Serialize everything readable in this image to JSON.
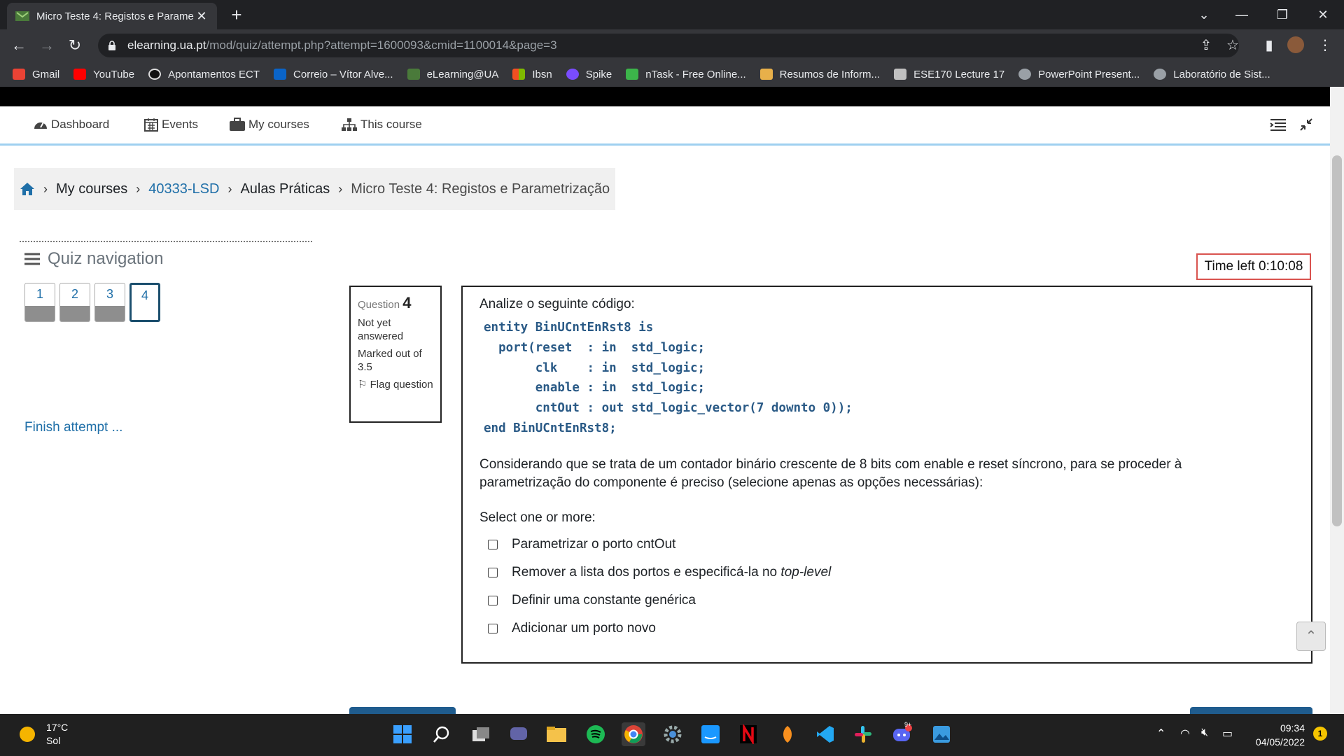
{
  "browser": {
    "tab_title": "Micro Teste 4: Registos e Parame",
    "tab_close": "✕",
    "new_tab": "+",
    "url_host": "elearning.ua.pt",
    "url_path": "/mod/quiz/attempt.php?attempt=1600093&cmid=1100014&page=3",
    "bookmarks": [
      {
        "label": "Gmail",
        "icon": "gmail-icon",
        "color": "#ea4335"
      },
      {
        "label": "YouTube",
        "icon": "youtube-icon",
        "color": "#ff0000"
      },
      {
        "label": "Apontamentos ECT",
        "icon": "ect-icon",
        "color": "#111111"
      },
      {
        "label": "Correio – Vítor Alve...",
        "icon": "outlook-icon",
        "color": "#0a64c8"
      },
      {
        "label": "eLearning@UA",
        "icon": "elearning-icon",
        "color": "#4a7a3a"
      },
      {
        "label": "Ibsn",
        "icon": "windows-icon",
        "color": "#f25022"
      },
      {
        "label": "Spike",
        "icon": "spike-icon",
        "color": "#7a4cff"
      },
      {
        "label": "nTask - Free Online...",
        "icon": "ntask-icon",
        "color": "#3cb54a"
      },
      {
        "label": "Resumos de Inform...",
        "icon": "box-icon",
        "color": "#e8b04a"
      },
      {
        "label": "ESE170 Lecture 17",
        "icon": "shield-icon",
        "color": "#c0c0c0"
      },
      {
        "label": "PowerPoint Present...",
        "icon": "globe-icon",
        "color": "#9aa0a6"
      },
      {
        "label": "Laboratório de Sist...",
        "icon": "globe-icon",
        "color": "#9aa0a6"
      }
    ]
  },
  "nav": {
    "dashboard": "Dashboard",
    "events": "Events",
    "my_courses": "My courses",
    "this_course": "This course"
  },
  "breadcrumb": {
    "items": [
      "My courses",
      "40333-LSD",
      "Aulas Práticas",
      "Micro Teste 4: Registos e Parametrização"
    ]
  },
  "quiz_nav": {
    "title": "Quiz navigation",
    "questions": [
      "1",
      "2",
      "3",
      "4"
    ],
    "current": "4",
    "finish": "Finish attempt ..."
  },
  "timer": {
    "label": "Time left 0:10:08"
  },
  "question": {
    "label": "Question",
    "number": "4",
    "status": "Not yet answered",
    "marked": "Marked out of 3.5",
    "flag": "Flag question",
    "intro": "Analize o seguinte código:",
    "code": [
      "entity BinUCntEnRst8 is",
      "  port(reset  : in  std_logic;",
      "       clk    : in  std_logic;",
      "       enable : in  std_logic;",
      "       cntOut : out std_logic_vector(7 downto 0));",
      "end BinUCntEnRst8;"
    ],
    "text": "Considerando que se trata de um contador binário crescente de 8 bits com enable e reset síncrono, para se proceder à parametrização do componente é preciso (selecione apenas as opções necessárias):",
    "select_prompt": "Select one or more:",
    "options": [
      {
        "text": "Parametrizar o porto cntOut",
        "italic": ""
      },
      {
        "text": "Remover a lista dos portos e especificá-la no ",
        "italic": "top-level"
      },
      {
        "text": "Definir uma constante genérica",
        "italic": ""
      },
      {
        "text": "Adicionar um porto novo",
        "italic": ""
      }
    ]
  },
  "taskbar": {
    "temp": "17°C",
    "weather": "Sol",
    "time": "09:34",
    "date": "04/05/2022",
    "notifications": "1",
    "discord_badge": "9+"
  }
}
